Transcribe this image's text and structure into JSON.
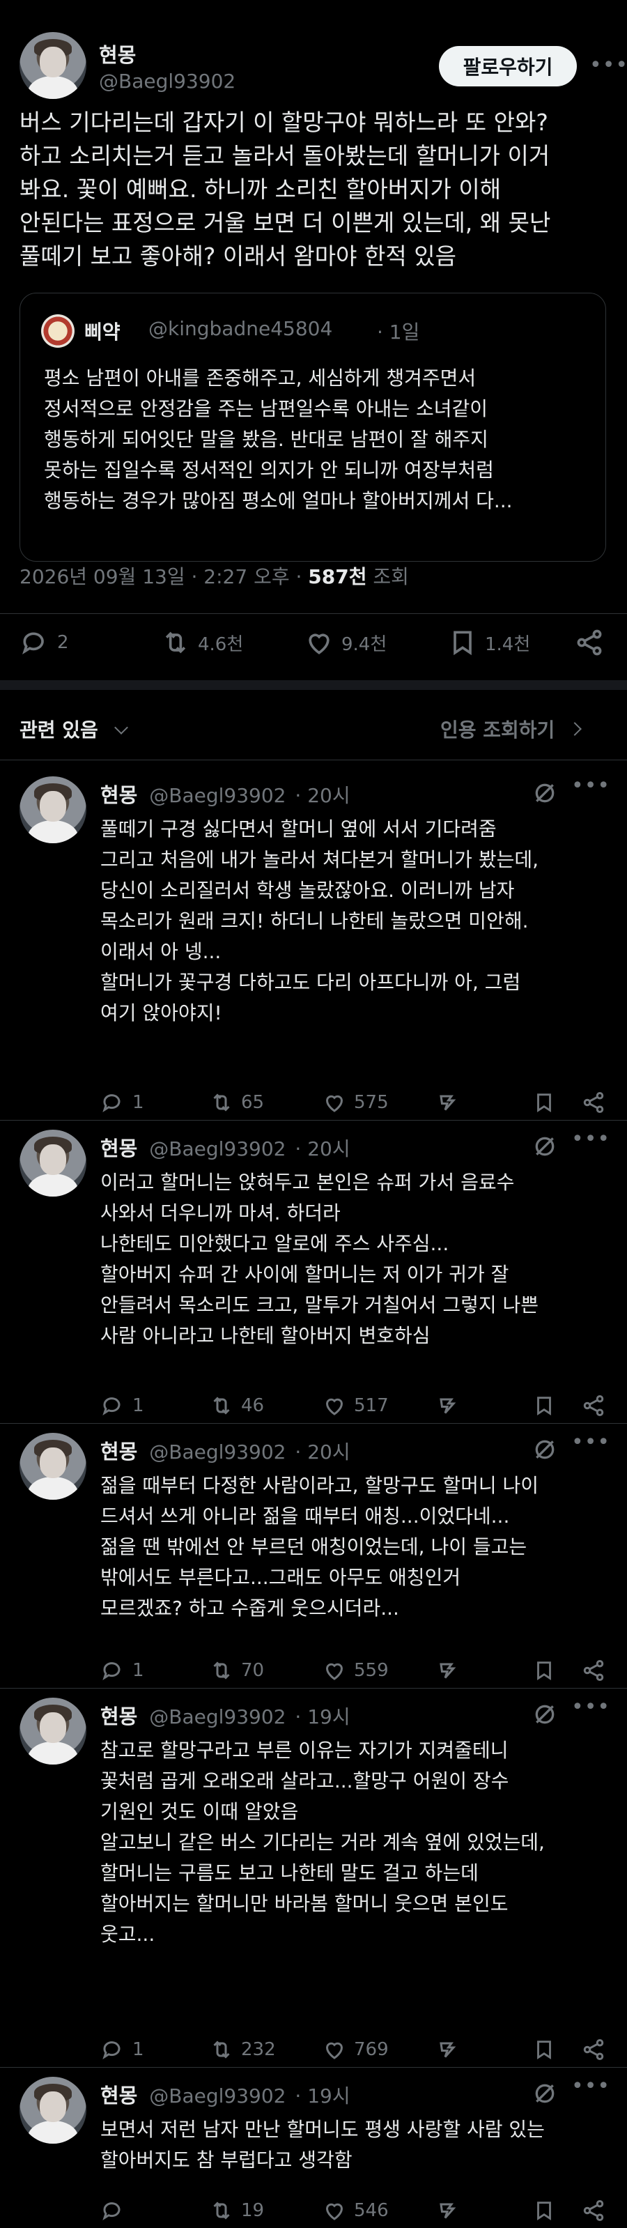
{
  "main_post": {
    "author_name": "현몽",
    "author_handle": "@Baegl93902",
    "follow_label": "팔로우하기",
    "text": "버스 기다리는데 갑자기 이 할망구야 뭐하느라 또 안와?\n하고 소리치는거 듣고 놀라서 돌아봤는데 할머니가 이거\n봐요. 꽃이 예뻐요. 하니까 소리친 할아버지가 이해\n안된다는 표정으로 거울 보면 더 이쁜게 있는데, 왜 못난\n풀떼기 보고 좋아해? 이래서 왐마야 한적 있음",
    "quote": {
      "author_name": "삐약",
      "author_handle": "@kingbadne45804",
      "time": "· 1일",
      "text": "평소 남편이 아내를 존중해주고, 세심하게 챙겨주면서\n정서적으로 안정감을 주는 남편일수록 아내는 소녀같이\n행동하게 되어잇단 말을 봤음. 반대로 남편이 잘 해주지\n못하는 집일수록 정서적인 의지가 안 되니까 여장부처럼\n행동하는 경우가 많아짐 평소에 얼마나 할아버지께서 다..."
    },
    "date_time": "2026년 09월 13일 · 2:27 오후 · ",
    "views_count": "587천",
    "views_label": " 조회",
    "stats": {
      "replies": "2",
      "reposts": "4.6천",
      "likes": "9.4천",
      "bookmarks": "1.4천"
    }
  },
  "related": {
    "label": "관련 있음",
    "quote_view_label": "인용 조회하기"
  },
  "replies": [
    {
      "name": "현몽",
      "handle": "@Baegl93902",
      "time": "· 20시",
      "text": "풀떼기 구경 싫다면서 할머니 옆에 서서 기다려줌\n그리고 처음에 내가 놀라서 쳐다본거 할머니가 봤는데,\n당신이 소리질러서 학생 놀랐잖아요. 이러니까 남자\n목소리가 원래 크지! 하더니 나한테 놀랐으면 미안해.\n이래서 아 넹...\n할머니가 꽃구경 다하고도 다리 아프다니까 아, 그럼\n여기 앉아야지!",
      "replies": "1",
      "reposts": "65",
      "likes": "575"
    },
    {
      "name": "현몽",
      "handle": "@Baegl93902",
      "time": "· 20시",
      "text": "이러고 할머니는 앉혀두고 본인은 슈퍼 가서 음료수\n사와서 더우니까 마셔. 하더라\n나한테도 미안했다고 알로에 주스 사주심...\n할아버지 슈퍼 간 사이에 할머니는 저 이가 귀가 잘\n안들려서 목소리도 크고, 말투가 거칠어서 그렇지 나쁜\n사람 아니라고 나한테 할아버지 변호하심",
      "replies": "1",
      "reposts": "46",
      "likes": "517"
    },
    {
      "name": "현몽",
      "handle": "@Baegl93902",
      "time": "· 20시",
      "text": "젊을 때부터 다정한 사람이라고, 할망구도 할머니 나이\n드셔서 쓰게 아니라 젊을 때부터 애칭...이었다네...\n젊을 땐 밖에선 안 부르던 애칭이었는데, 나이 들고는\n밖에서도 부른다고...그래도 아무도 애칭인거\n모르겠죠? 하고 수줍게 웃으시더라...",
      "replies": "1",
      "reposts": "70",
      "likes": "559"
    },
    {
      "name": "현몽",
      "handle": "@Baegl93902",
      "time": "· 19시",
      "text": "참고로 할망구라고 부른 이유는 자기가 지켜줄테니\n꽃처럼 곱게 오래오래 살라고...할망구 어원이 장수\n기원인 것도 이때 알았음\n알고보니 같은 버스 기다리는 거라 계속 옆에 있었는데,\n할머니는 구름도 보고 나한테 말도 걸고 하는데\n할아버지는 할머니만 바라봄 할머니 웃으면 본인도\n웃고...",
      "replies": "1",
      "reposts": "232",
      "likes": "769"
    },
    {
      "name": "현몽",
      "handle": "@Baegl93902",
      "time": "· 19시",
      "text": "보면서 저런 남자 만난 할머니도 평생 사랑할 사람 있는\n할아버지도 참 부럽다고 생각함",
      "replies": "",
      "reposts": "19",
      "likes": "546"
    }
  ]
}
